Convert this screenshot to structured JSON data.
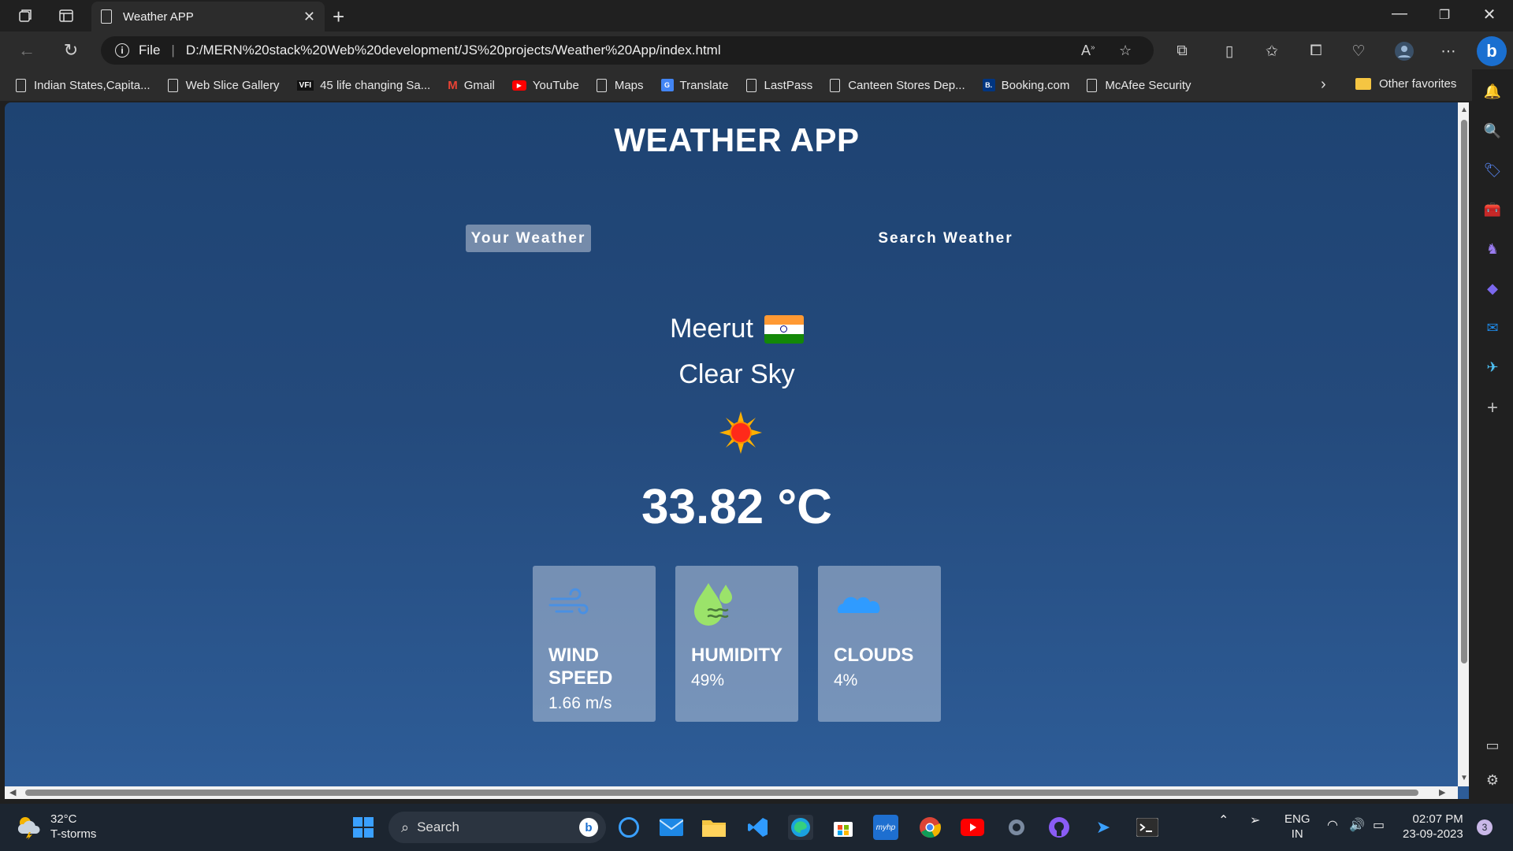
{
  "browser": {
    "tab_title": "Weather APP",
    "url_scheme": "File",
    "url": "D:/MERN%20stack%20Web%20development/JS%20projects/Weather%20App/index.html"
  },
  "favorites": [
    {
      "label": "Indian States,Capita..."
    },
    {
      "label": "Web Slice Gallery"
    },
    {
      "label": "45 life changing Sa...",
      "badge": "VFI"
    },
    {
      "label": "Gmail"
    },
    {
      "label": "YouTube"
    },
    {
      "label": "Maps"
    },
    {
      "label": "Translate"
    },
    {
      "label": "LastPass"
    },
    {
      "label": "Canteen Stores Dep..."
    },
    {
      "label": "Booking.com",
      "badge": "B."
    },
    {
      "label": "McAfee Security"
    }
  ],
  "favorites_other": "Other favorites",
  "app": {
    "title": "WEATHER APP",
    "tab_active": "Your Weather",
    "tab_inactive": "Search Weather",
    "city": "Meerut",
    "description": "Clear Sky",
    "temperature": "33.82 °C",
    "cards": {
      "wind": {
        "label_1": "WIND",
        "label_2": "SPEED",
        "value": "1.66 m/s"
      },
      "humidity": {
        "label": "HUMIDITY",
        "value": "49%"
      },
      "clouds": {
        "label": "CLOUDS",
        "value": "4%"
      }
    }
  },
  "taskbar": {
    "weather_temp": "32°C",
    "weather_desc": "T-storms",
    "search_label": "Search",
    "lang_1": "ENG",
    "lang_2": "IN",
    "time": "02:07 PM",
    "date": "23-09-2023",
    "notif_count": "3"
  },
  "colors": {
    "page_top": "#1e4372",
    "page_bottom": "#2e5d98",
    "card_bg": "rgba(210,220,235,0.45)",
    "wind_icon": "#4a90e2",
    "humidity_icon": "#9be36a",
    "clouds_icon": "#2f9bff"
  }
}
